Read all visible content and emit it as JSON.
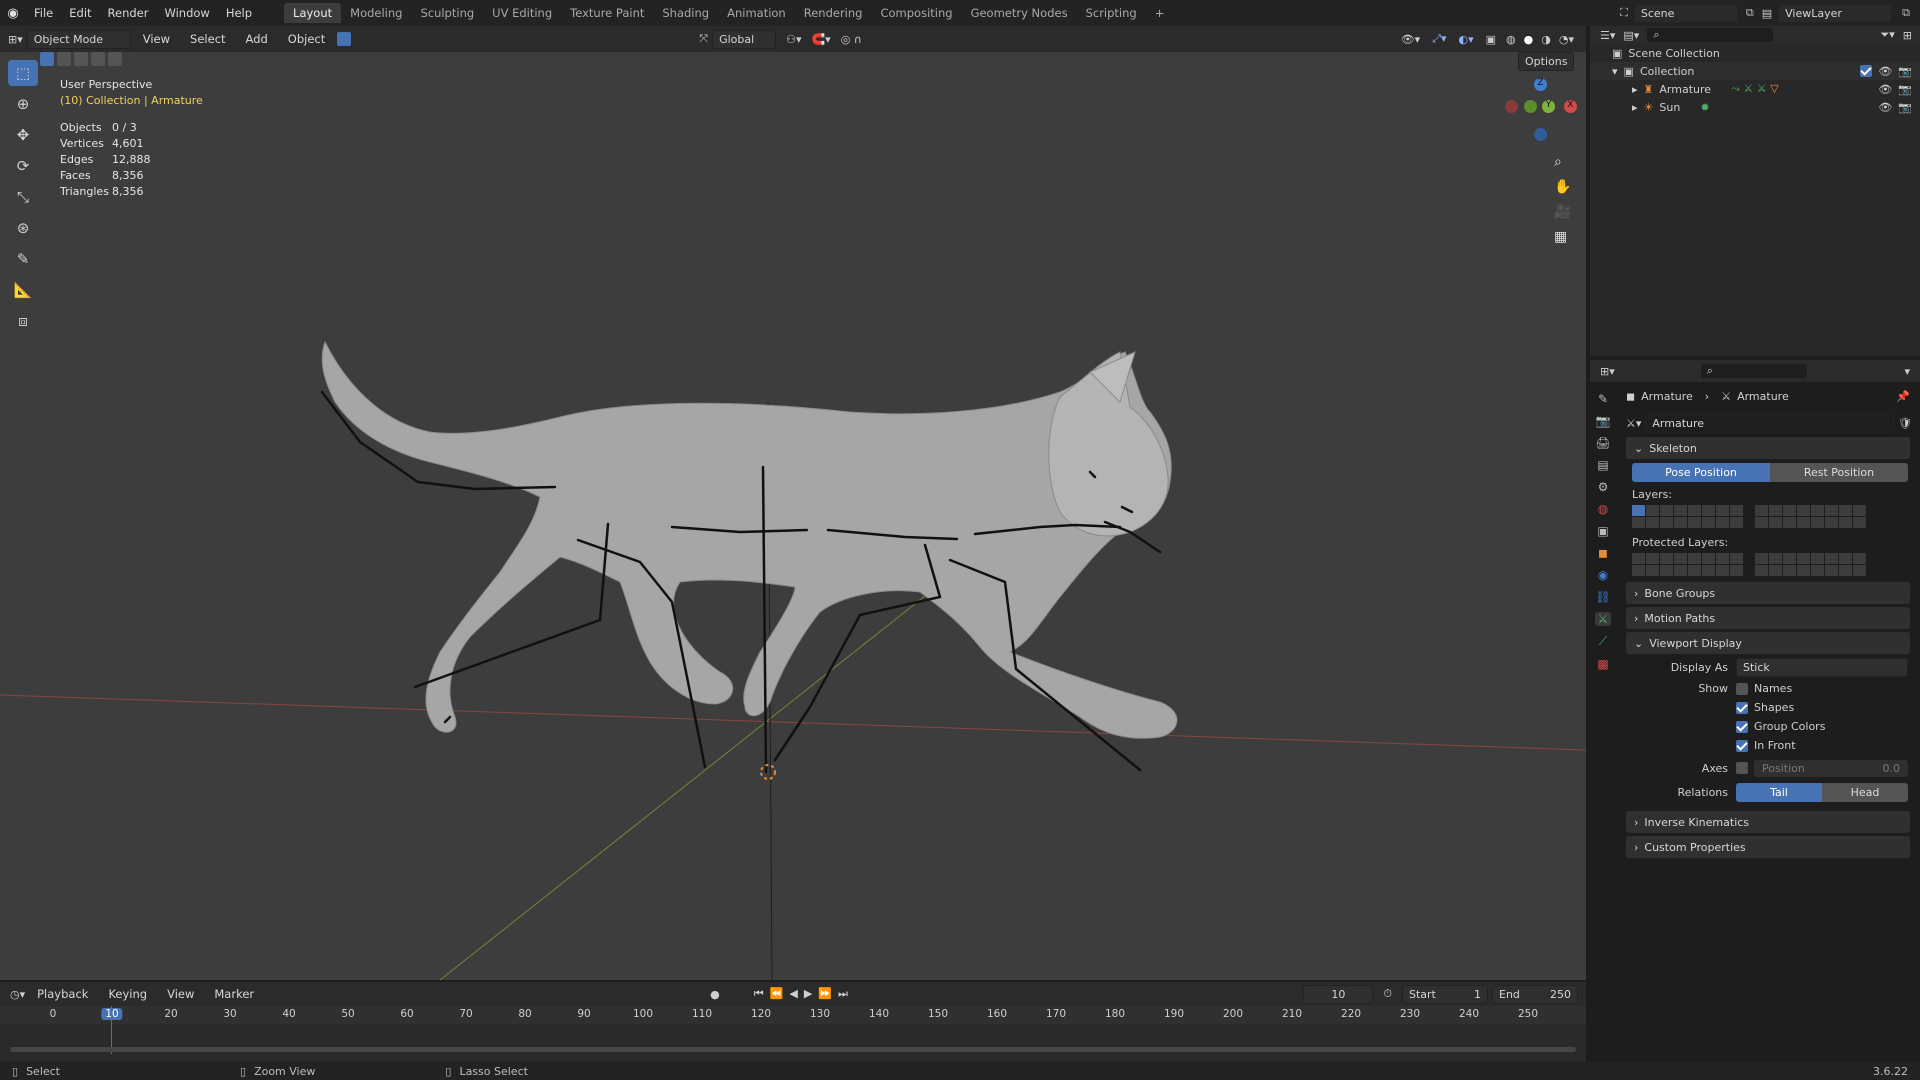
{
  "topbar": {
    "menus": [
      "File",
      "Edit",
      "Render",
      "Window",
      "Help"
    ],
    "workspaces": [
      "Layout",
      "Modeling",
      "Sculpting",
      "UV Editing",
      "Texture Paint",
      "Shading",
      "Animation",
      "Rendering",
      "Compositing",
      "Geometry Nodes",
      "Scripting"
    ],
    "active_workspace": "Layout",
    "add_tab": "+",
    "scene": "Scene",
    "view_layer": "ViewLayer"
  },
  "viewport_header": {
    "mode": "Object Mode",
    "menus": [
      "View",
      "Select",
      "Add",
      "Object"
    ],
    "orientation": "Global",
    "options": "Options"
  },
  "overlay": {
    "view_name": "User Perspective",
    "collection": "(10) Collection | Armature",
    "stats": [
      {
        "k": "Objects",
        "v": "0 / 3"
      },
      {
        "k": "Vertices",
        "v": "4,601"
      },
      {
        "k": "Edges",
        "v": "12,888"
      },
      {
        "k": "Faces",
        "v": "8,356"
      },
      {
        "k": "Triangles",
        "v": "8,356"
      }
    ]
  },
  "gizmo": {
    "z": "Z",
    "y": "Y",
    "x": "X"
  },
  "outliner": {
    "root": "Scene Collection",
    "collection": "Collection",
    "items": [
      "Armature",
      "Sun"
    ]
  },
  "props": {
    "breadcrumb_a": "Armature",
    "breadcrumb_b": "Armature",
    "data_name": "Armature",
    "skeleton": "Skeleton",
    "pose_position": "Pose Position",
    "rest_position": "Rest Position",
    "layers": "Layers:",
    "protected_layers": "Protected Layers:",
    "bone_groups": "Bone Groups",
    "motion_paths": "Motion Paths",
    "viewport_display": "Viewport Display",
    "display_as_label": "Display As",
    "display_as_value": "Stick",
    "show_label": "Show",
    "names": "Names",
    "shapes": "Shapes",
    "group_colors": "Group Colors",
    "in_front": "In Front",
    "axes_label": "Axes",
    "axes_position": "Position",
    "axes_value": "0.0",
    "relations_label": "Relations",
    "tail": "Tail",
    "head": "Head",
    "inverse_kinematics": "Inverse Kinematics",
    "custom_properties": "Custom Properties"
  },
  "timeline": {
    "menus": [
      "Playback",
      "Keying",
      "View",
      "Marker"
    ],
    "current_frame": "10",
    "start_label": "Start",
    "start_value": "1",
    "end_label": "End",
    "end_value": "250",
    "ticks": [
      "0",
      "10",
      "20",
      "30",
      "40",
      "50",
      "60",
      "70",
      "80",
      "90",
      "100",
      "110",
      "120",
      "130",
      "140",
      "150",
      "160",
      "170",
      "180",
      "190",
      "200",
      "210",
      "220",
      "230",
      "240",
      "250"
    ]
  },
  "statusbar": {
    "select": "Select",
    "zoom": "Zoom View",
    "lasso": "Lasso Select",
    "version": "3.6.22"
  },
  "colors": {
    "accent": "#4772b3",
    "x_axis": "#d24b4b",
    "y_axis": "#7db33b",
    "z_axis": "#3f7fd1"
  }
}
